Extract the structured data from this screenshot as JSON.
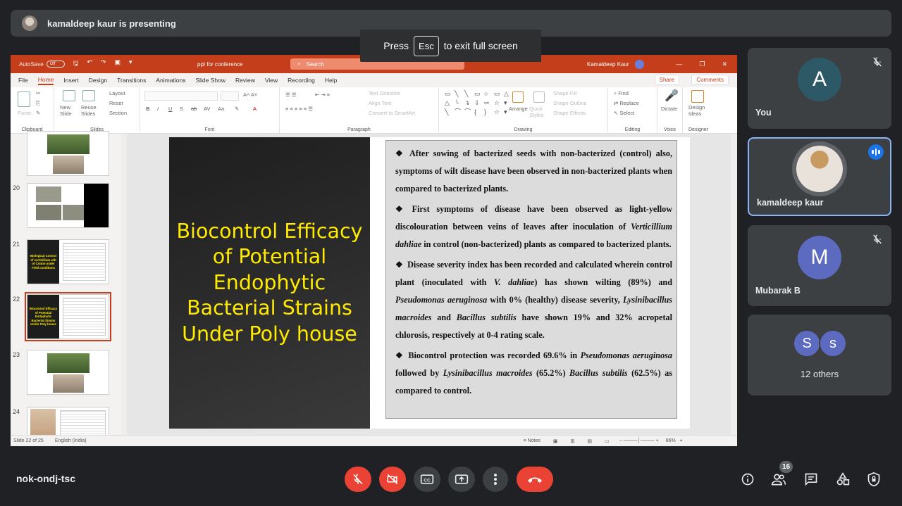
{
  "presenter_bar": {
    "text": "kamaldeep kaur is presenting"
  },
  "esc_toast": {
    "press": "Press",
    "key": "Esc",
    "suffix": "to exit full screen"
  },
  "powerpoint": {
    "autosave_label": "AutoSave",
    "autosave_state": "Off",
    "filename": "ppt for conference",
    "search_placeholder": "Search",
    "user": "Kamaldeep Kaur",
    "tabs": [
      "File",
      "Home",
      "Insert",
      "Design",
      "Transitions",
      "Animations",
      "Slide Show",
      "Review",
      "View",
      "Recording",
      "Help"
    ],
    "active_tab": "Home",
    "share_label": "Share",
    "comments_label": "Comments",
    "ribbon": {
      "clipboard": {
        "label": "Clipboard",
        "paste": "Paste"
      },
      "slides": {
        "label": "Slides",
        "new_slide": "New Slide",
        "reuse_slides": "Reuse Slides",
        "layout": "Layout",
        "reset": "Reset",
        "section": "Section"
      },
      "font": {
        "label": "Font"
      },
      "paragraph": {
        "label": "Paragraph",
        "text_direction": "Text Direction",
        "align_text": "Align Text",
        "smartart": "Convert to SmartArt"
      },
      "drawing": {
        "label": "Drawing",
        "arrange": "Arrange",
        "quick_styles": "Quick Styles",
        "shape_fill": "Shape Fill",
        "shape_outline": "Shape Outline",
        "shape_effects": "Shape Effects"
      },
      "editing": {
        "label": "Editing",
        "find": "Find",
        "replace": "Replace",
        "select": "Select"
      },
      "voice": {
        "label": "Voice",
        "dictate": "Dictate"
      },
      "designer": {
        "label": "Designer",
        "design_ideas": "Design Ideas"
      }
    },
    "thumbnails": [
      {
        "num": "",
        "kind": "photos"
      },
      {
        "num": "20",
        "kind": "photos-dark"
      },
      {
        "num": "21",
        "kind": "title-text",
        "title": "Biological Control of verticillium wilt of Cotton under Field conditions"
      },
      {
        "num": "22",
        "kind": "title-text",
        "title": "Biocontrol Efficacy of Potential Endophytic Bacterial Strains Under Poly house",
        "selected": true
      },
      {
        "num": "23",
        "kind": "photos"
      },
      {
        "num": "24",
        "kind": "photos-text"
      }
    ],
    "slide": {
      "title": "Biocontrol Efficacy of Potential Endophytic Bacterial Strains Under Poly house",
      "bullets": [
        {
          "segments": [
            {
              "t": "After sowing of bacterized seeds with non-bacterized (control) also, symptoms of wilt disease have been observed in non-bacterized plants when compared to bacterized plants."
            }
          ]
        },
        {
          "segments": [
            {
              "t": "First symptoms of disease have been observed as light-yellow discolouration between veins of leaves after inoculation of "
            },
            {
              "t": "Verticillium dahliae",
              "i": true
            },
            {
              "t": " in control (non-bacterized) plants as compared to bacterized plants."
            }
          ]
        },
        {
          "segments": [
            {
              "t": "Disease severity index has been recorded and calculated wherein control plant (inoculated with "
            },
            {
              "t": "V. dahliae",
              "i": true
            },
            {
              "t": ") has shown wilting (89%) and "
            },
            {
              "t": "Pseudomonas aeruginosa",
              "i": true
            },
            {
              "t": " with 0% (healthy) disease severity, "
            },
            {
              "t": "Lysinibacillus macroides",
              "i": true
            },
            {
              "t": " and "
            },
            {
              "t": "Bacillus subtilis",
              "i": true
            },
            {
              "t": " have shown 19% and 32% acropetal chlorosis, respectively at 0-4 rating scale."
            }
          ]
        },
        {
          "segments": [
            {
              "t": "Biocontrol protection was recorded 69.6% in "
            },
            {
              "t": "Pseudomonas aeruginosa",
              "i": true
            },
            {
              "t": " followed by "
            },
            {
              "t": "Lysinibacillus macroides",
              "i": true
            },
            {
              "t": " (65.2%) "
            },
            {
              "t": "Bacillus subtilis",
              "i": true
            },
            {
              "t": " (62.5%) as compared to control."
            }
          ]
        }
      ]
    },
    "status": {
      "slide_count": "Slide 22 of 25",
      "language": "English (India)",
      "notes": "Notes",
      "zoom": "86%"
    }
  },
  "participants": [
    {
      "name": "You",
      "initial": "A",
      "color": "#2d5967",
      "muted": true
    },
    {
      "name": "kamaldeep kaur",
      "speaking": true
    },
    {
      "name": "Mubarak B",
      "initial": "M",
      "color": "#5c6bc0",
      "muted": true
    },
    {
      "name": "12 others",
      "initials": [
        "S",
        "s"
      ],
      "color": "#5c6bc0"
    }
  ],
  "bottom": {
    "meeting_code": "nok-ondj-tsc",
    "participant_count": "16"
  },
  "colors": {
    "end_call": "#ea4335",
    "accent": "#1a73e8",
    "ppt_brand": "#c43e1c",
    "slide_title": "#ffea00"
  }
}
